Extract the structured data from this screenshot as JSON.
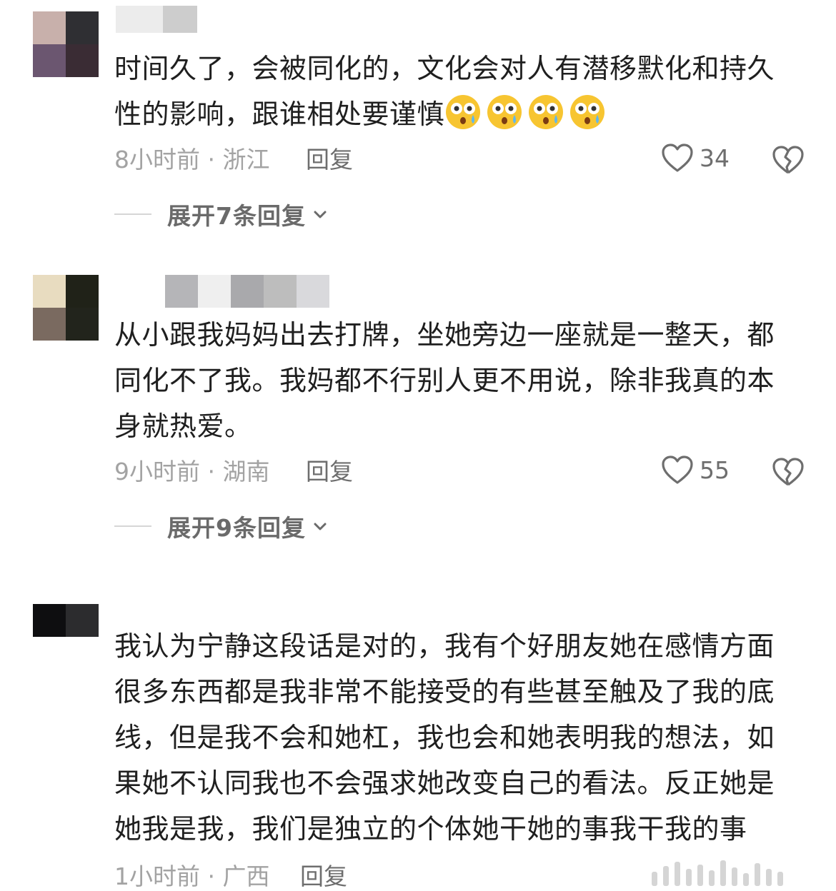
{
  "comments": [
    {
      "avatar_colors": [
        "#c8b0ab",
        "#2f2f33",
        "#6b5670",
        "#3a2c34"
      ],
      "name_blur_colors": [
        "#e6e6e6",
        "#c9c9c9"
      ],
      "text": "时间久了，会被同化的，文化会对人有潜移默化和持久性的影响，跟谁相处要谨慎",
      "emoji_count": 4,
      "emoji_name": "astonished-face-emoji",
      "time": "8小时前",
      "location": "浙江",
      "meta": "8小时前 · 浙江",
      "reply_label": "回复",
      "likes": "34",
      "expand_label": "展开7条回复"
    },
    {
      "avatar_colors": [
        "#e8dcc0",
        "#202218",
        "#7a6a60",
        "#22241c"
      ],
      "name_blur_colors": [
        "#b5b5b8",
        "#efefef",
        "#a9a9ac",
        "#bdbdbd",
        "#d9d9dc"
      ],
      "text": "从小跟我妈妈出去打牌，坐她旁边一座就是一整天，都同化不了我。我妈都不行别人更不用说，除非我真的本身就热爱。",
      "time": "9小时前",
      "location": "湖南",
      "meta": "9小时前 · 湖南",
      "reply_label": "回复",
      "likes": "55",
      "expand_label": "展开9条回复"
    },
    {
      "avatar_colors": [
        "#0e0e10",
        "#2c2c2e",
        "#ffffff",
        "#ffffff"
      ],
      "name_blur_colors": [],
      "text": "我认为宁静这段话是对的，我有个好朋友她在感情方面很多东西都是我非常不能接受的有些甚至触及了我的底线，但是我不会和她杠，我也会和她表明我的想法，如果她不认同我也不会强求她改变自己的看法。反正她是她我是我，我们是独立的个体她干她的事我干我的事",
      "time": "1小时前",
      "location": "广西",
      "meta": "1小时前 · 广西",
      "reply_label": "回复"
    }
  ],
  "colors": {
    "text": "#1f1f1f",
    "meta": "#a3a3a3",
    "secondary": "#6e6e6e"
  }
}
